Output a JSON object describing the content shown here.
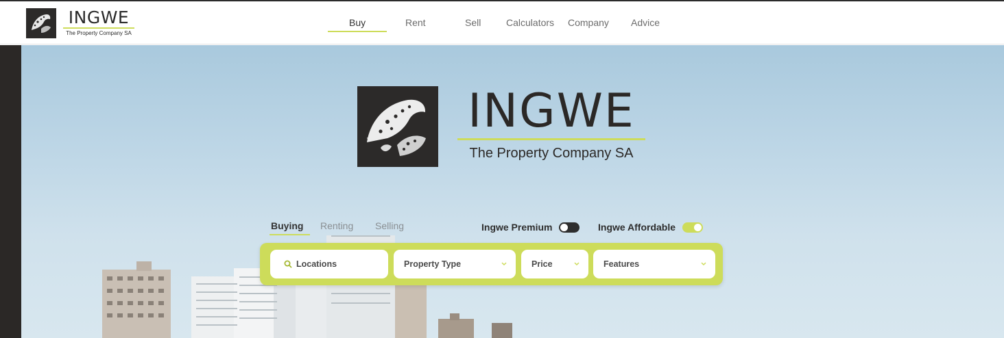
{
  "header": {
    "brand": "INGWE",
    "tagline": "The Property Company SA",
    "nav": [
      {
        "label": "Buy",
        "active": true
      },
      {
        "label": "Rent",
        "active": false
      },
      {
        "label": "Sell",
        "active": false
      },
      {
        "label": "Calculators",
        "active": false
      },
      {
        "label": "Company",
        "active": false
      },
      {
        "label": "Advice",
        "active": false
      }
    ]
  },
  "hero": {
    "brand": "INGWE",
    "tagline": "The Property Company SA"
  },
  "search": {
    "tabs": [
      {
        "label": "Buying",
        "active": true
      },
      {
        "label": "Renting",
        "active": false
      },
      {
        "label": "Selling",
        "active": false
      }
    ],
    "toggles": [
      {
        "label": "Ingwe Premium",
        "on": false
      },
      {
        "label": "Ingwe Affordable",
        "on": true
      }
    ],
    "fields": {
      "locations": "Locations",
      "property_type": "Property Type",
      "price": "Price",
      "features": "Features"
    }
  },
  "colors": {
    "accent": "#cddc5a",
    "dark": "#2b2826",
    "sky": "#bdd6e6"
  },
  "icons": [
    "leopard-logo-icon",
    "search-icon",
    "chevron-down-icon"
  ]
}
